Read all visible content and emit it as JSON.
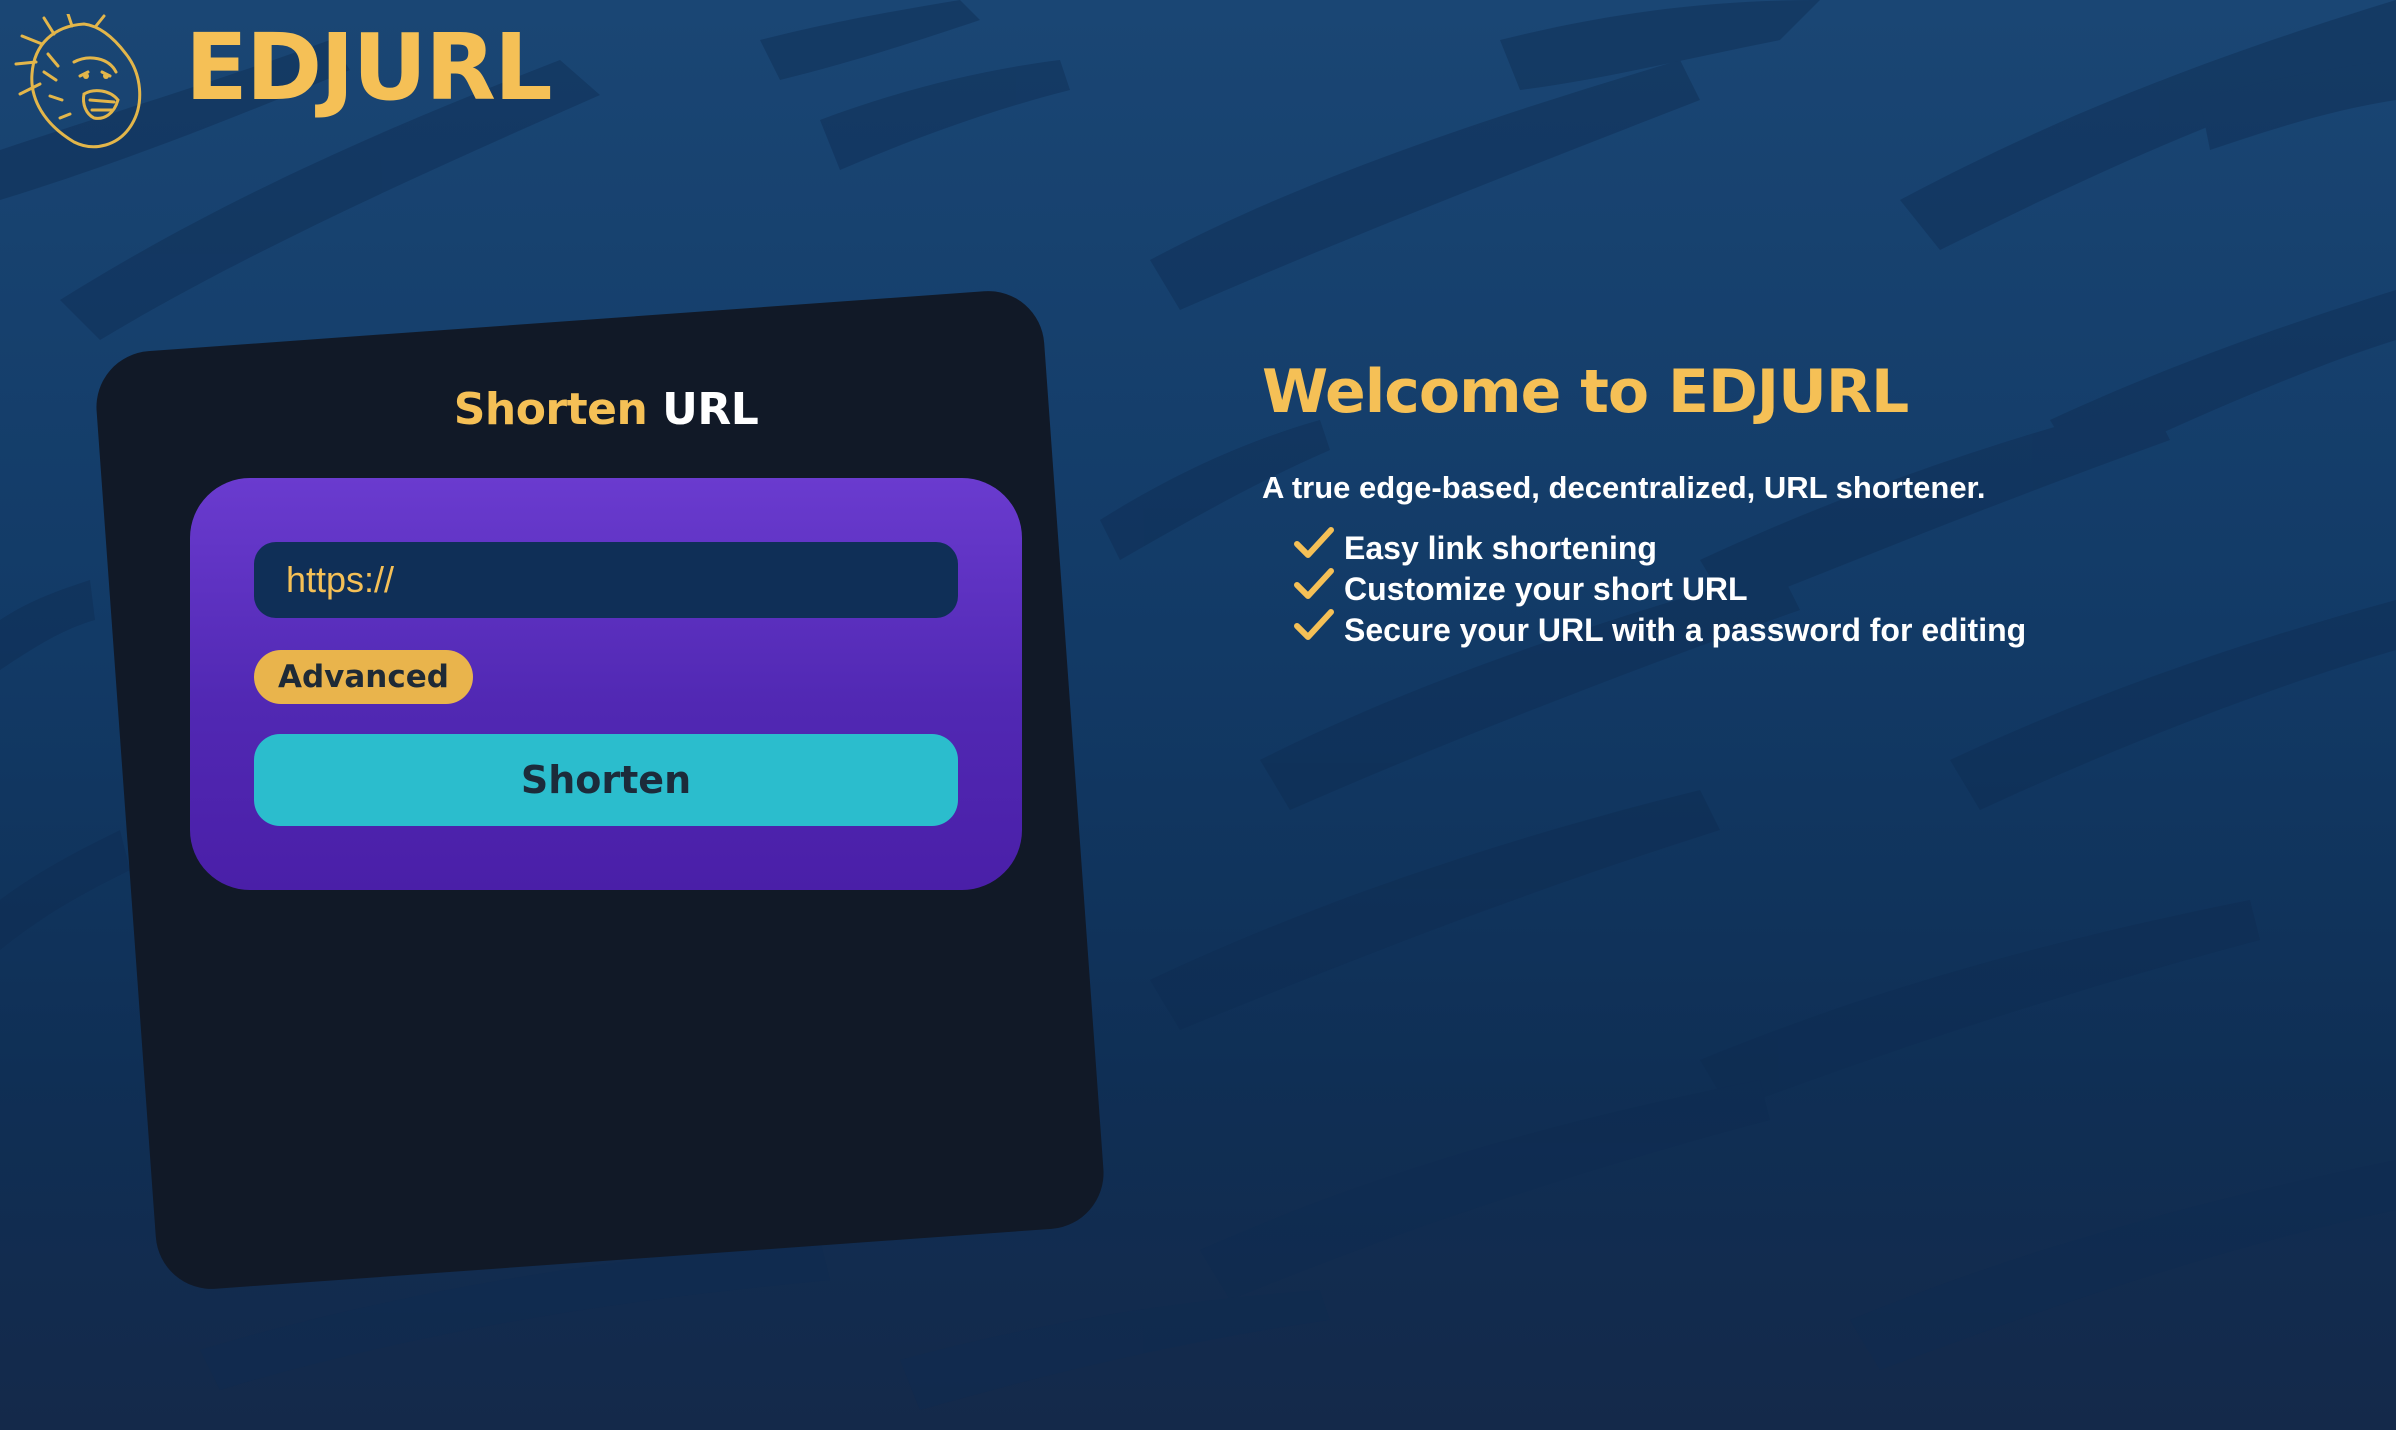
{
  "colors": {
    "accent": "#f5c056",
    "card_bg": "#111927",
    "form_gradient_top": "#6a3bcf",
    "form_gradient_bottom": "#4a1fa8",
    "input_bg": "#0f2f57",
    "advanced_bg": "#e9b44c",
    "shorten_bg": "#2bbdcd",
    "text_white": "#ffffff"
  },
  "header": {
    "logo_icon": "gorilla-logo-icon",
    "brand": "EDJURL"
  },
  "card": {
    "title_part1": "Shorten",
    "title_part2": "URL",
    "url_input": {
      "placeholder": "https://",
      "value": ""
    },
    "advanced_label": "Advanced",
    "shorten_label": "Shorten"
  },
  "welcome": {
    "title": "Welcome to EDJURL",
    "subtitle": "A true edge-based, decentralized, URL shortener.",
    "check_icon": "checkmark-icon",
    "features": [
      "Easy link shortening",
      "Customize your short URL",
      "Secure your URL with a password for editing"
    ]
  }
}
